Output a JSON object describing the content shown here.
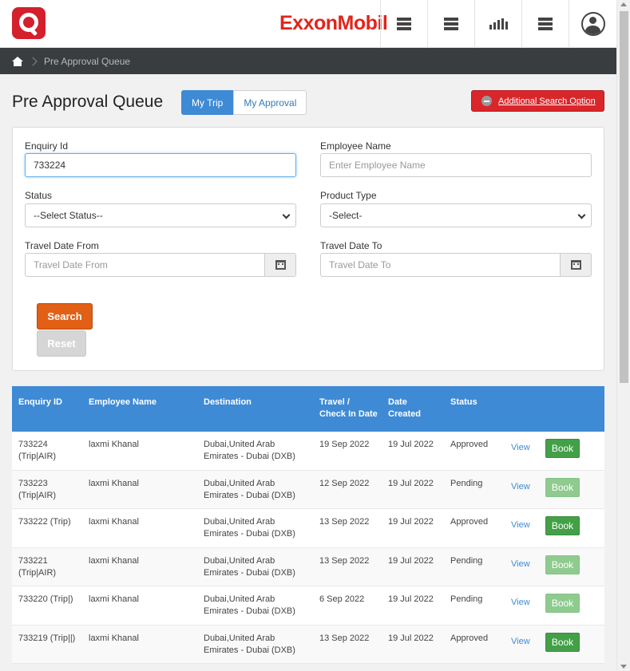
{
  "header": {
    "brand": "ExxonMobil",
    "nav_icons": [
      "menu-icon",
      "menu-icon",
      "chart-icon",
      "menu-icon",
      "user-icon"
    ]
  },
  "breadcrumb": {
    "current": "Pre Approval Queue"
  },
  "page": {
    "title": "Pre Approval Queue",
    "tabs": [
      {
        "label": "My Trip",
        "active": true
      },
      {
        "label": "My Approval",
        "active": false
      }
    ],
    "additional_search_label": "Additional Search Option"
  },
  "form": {
    "enquiry_id": {
      "label": "Enquiry Id",
      "value": "733224"
    },
    "employee_name": {
      "label": "Employee Name",
      "placeholder": "Enter Employee Name"
    },
    "status": {
      "label": "Status",
      "selected": "--Select Status--"
    },
    "product_type": {
      "label": "Product Type",
      "selected": "-Select-"
    },
    "travel_from": {
      "label": "Travel Date From",
      "placeholder": "Travel Date From"
    },
    "travel_to": {
      "label": "Travel Date To",
      "placeholder": "Travel Date To"
    },
    "search_label": "Search",
    "reset_label": "Reset"
  },
  "table": {
    "headers": [
      "Enquiry ID",
      "Employee Name",
      "Destination",
      "Travel /",
      "Check In Date",
      "Date",
      "Created",
      "Status"
    ],
    "rows": [
      {
        "id1": "733224",
        "id2": "(Trip|AIR)",
        "name": "laxmi Khanal",
        "dest1": "Dubai,United Arab",
        "dest2": "Emirates - Dubai (DXB)",
        "travel": "19 Sep 2022",
        "created": "19 Jul 2022",
        "status": "Approved",
        "view": "View",
        "book": "Book"
      },
      {
        "id1": "733223",
        "id2": "(Trip|AIR)",
        "name": "laxmi Khanal",
        "dest1": "Dubai,United Arab",
        "dest2": "Emirates - Dubai (DXB)",
        "travel": "12 Sep 2022",
        "created": "19 Jul 2022",
        "status": "Pending",
        "view": "View",
        "book": "Book"
      },
      {
        "id1": "733222 (Trip)",
        "id2": "",
        "name": "laxmi Khanal",
        "dest1": "Dubai,United Arab",
        "dest2": "Emirates - Dubai (DXB)",
        "travel": "13 Sep 2022",
        "created": "19 Jul 2022",
        "status": "Approved",
        "view": "View",
        "book": "Book"
      },
      {
        "id1": "733221",
        "id2": "(Trip|AIR)",
        "name": "laxmi Khanal",
        "dest1": "Dubai,United Arab",
        "dest2": "Emirates - Dubai (DXB)",
        "travel": "13 Sep 2022",
        "created": "19 Jul 2022",
        "status": "Pending",
        "view": "View",
        "book": "Book"
      },
      {
        "id1": "733220 (Trip|)",
        "id2": "",
        "name": "laxmi Khanal",
        "dest1": "Dubai,United Arab",
        "dest2": "Emirates - Dubai (DXB)",
        "travel": "6 Sep 2022",
        "created": "19 Jul 2022",
        "status": "Pending",
        "view": "View",
        "book": "Book"
      },
      {
        "id1": "733219 (Trip||)",
        "id2": "",
        "name": "laxmi Khanal",
        "dest1": "Dubai,United Arab",
        "dest2": "Emirates - Dubai (DXB)",
        "travel": "13 Sep 2022",
        "created": "19 Jul 2022",
        "status": "Approved",
        "view": "View",
        "book": "Book"
      }
    ]
  },
  "colors": {
    "primary": "#3e8ad5",
    "brand_red": "#e1251b",
    "search_orange": "#e25f16",
    "book_green": "#43a047"
  }
}
